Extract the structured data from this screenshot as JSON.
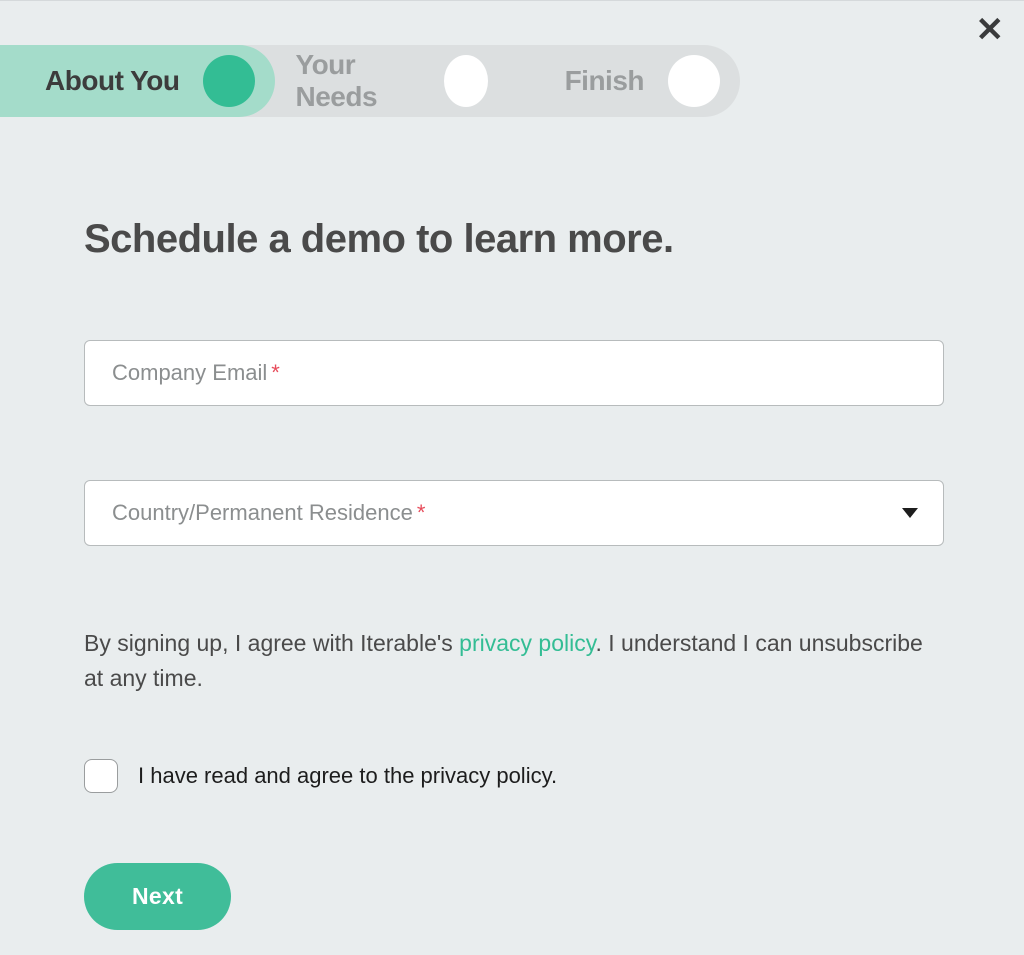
{
  "close_label": "✕",
  "stepper": {
    "steps": [
      {
        "label": "About You",
        "active": true
      },
      {
        "label": "Your Needs",
        "active": false
      },
      {
        "label": "Finish",
        "active": false
      }
    ]
  },
  "heading": "Schedule a demo to learn more.",
  "fields": {
    "email_label": "Company Email",
    "email_required_star": "*",
    "country_label": "Country/Permanent Residence",
    "country_required_star": "*"
  },
  "consent": {
    "prefix": "By signing up, I agree with Iterable's ",
    "link_text": "privacy policy",
    "suffix": ". I understand I can unsubscribe at any time."
  },
  "checkbox_label": "I have read and agree to the privacy policy.",
  "next_button": "Next"
}
